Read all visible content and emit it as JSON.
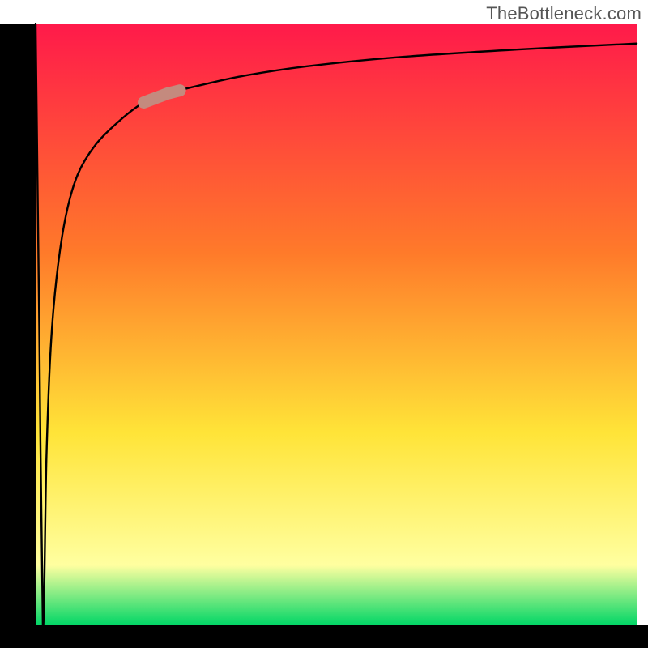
{
  "watermark": "TheBottleneck.com",
  "colors": {
    "axis": "#000000",
    "curve": "#000000",
    "marker_fill": "#c48a7e",
    "marker_stroke": "#c48a7e",
    "grad_top": "#ff1a4a",
    "grad_mid1": "#ff7a2a",
    "grad_mid2": "#ffe438",
    "grad_near_bottom": "#ffffa0",
    "grad_bottom": "#00d666"
  },
  "layout": {
    "plot_x": 44,
    "plot_y": 30,
    "plot_size": 742
  },
  "chart_data": {
    "type": "line",
    "title": "",
    "xlabel": "",
    "ylabel": "",
    "xlim": [
      0,
      100
    ],
    "ylim": [
      0,
      100
    ],
    "grid": false,
    "legend": false,
    "series": [
      {
        "name": "bottleneck-curve",
        "comment": "Approximate bottleneck curve: drops from 100 to 0 near x≈1.2 then rises logarithmically toward ~97 as x→100. Values are visual estimates read off the plot.",
        "x": [
          0,
          0.6,
          1.2,
          1.8,
          2.5,
          3.5,
          5,
          7,
          10,
          14,
          18,
          22,
          28,
          35,
          45,
          60,
          80,
          100
        ],
        "y": [
          100,
          50,
          0,
          28,
          46,
          58,
          68,
          75,
          80,
          84,
          87,
          88.5,
          90,
          91.5,
          93,
          94.5,
          95.8,
          96.8
        ]
      }
    ],
    "marker": {
      "comment": "Highlighted segment on the curve (salmon lozenge)",
      "x_range": [
        18,
        24
      ],
      "y_range": [
        86.5,
        89
      ]
    }
  }
}
